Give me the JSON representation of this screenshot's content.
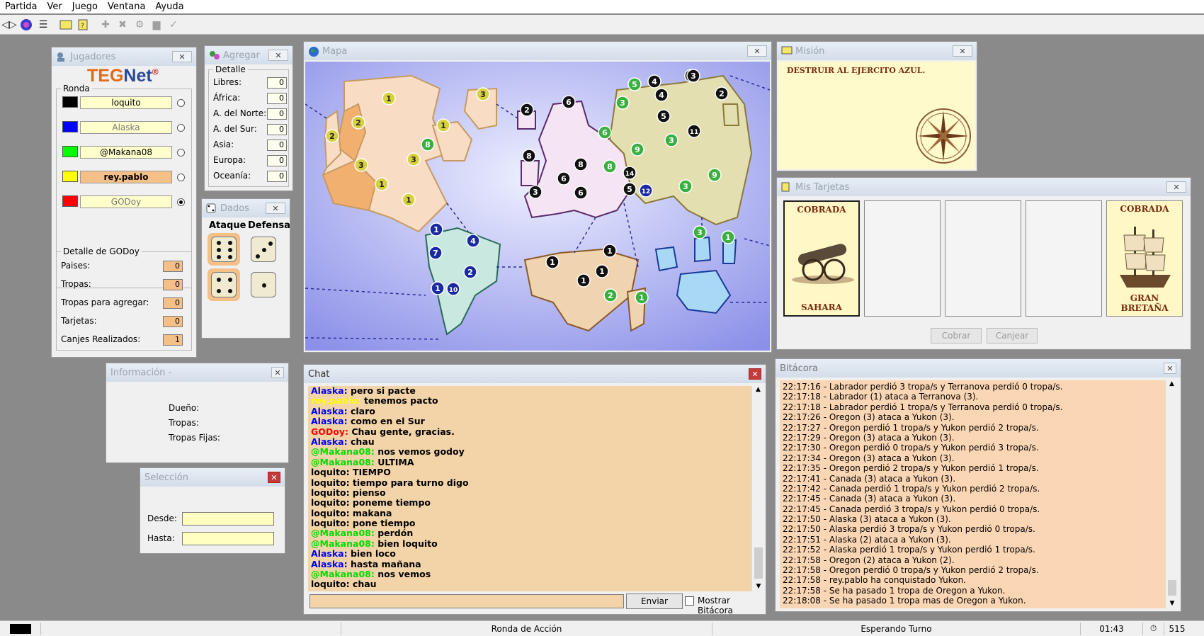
{
  "menu": [
    "Partida",
    "Ver",
    "Juego",
    "Ventana",
    "Ayuda"
  ],
  "jugadores": {
    "title": "Jugadores",
    "logo_a": "TEG",
    "logo_b": "Net",
    "logo_r": "®",
    "ronda_label": "Ronda",
    "players": [
      {
        "name": "loquito",
        "color": "#000000",
        "bold": false
      },
      {
        "name": "Alaska",
        "color": "#0000ff",
        "bold": false
      },
      {
        "name": "@Makana08",
        "color": "#00ff00",
        "bold": false
      },
      {
        "name": "rey.pablo",
        "color": "#ffff00",
        "bold": true
      },
      {
        "name": "GODoy",
        "color": "#ff0000",
        "bold": false
      }
    ],
    "detalle_title": "Detalle de GODoy",
    "detalle": [
      {
        "label": "Paises:",
        "value": "0"
      },
      {
        "label": "Tropas:",
        "value": "0"
      },
      {
        "label": "Tropas para agregar:",
        "value": "0"
      },
      {
        "label": "Tarjetas:",
        "value": "0"
      },
      {
        "label": "Canjes Realizados:",
        "value": "1"
      }
    ]
  },
  "agregar": {
    "title": "Agregar",
    "detalle_label": "Detalle",
    "rows": [
      {
        "label": "Libres:",
        "value": "0"
      },
      {
        "label": "África:",
        "value": "0"
      },
      {
        "label": "A. del Norte:",
        "value": "0"
      },
      {
        "label": "A. del Sur:",
        "value": "0"
      },
      {
        "label": "Asia:",
        "value": "0"
      },
      {
        "label": "Europa:",
        "value": "0"
      },
      {
        "label": "Oceanía:",
        "value": "0"
      }
    ]
  },
  "dados": {
    "title": "Dados",
    "ataque": "Ataque",
    "defensa": "Defensa",
    "attack": [
      6,
      4
    ],
    "defense": [
      3,
      1
    ]
  },
  "mapa": {
    "title": "Mapa"
  },
  "mision": {
    "title": "Misión",
    "text": "DESTRUIR AL EJERCITO AZUL."
  },
  "tarjetas": {
    "title": "Mis Tarjetas",
    "cards": [
      {
        "status": "COBRADA",
        "country": "SAHARA",
        "icon": "cannon-icon"
      },
      {
        "status": "COBRADA",
        "country": "GRAN BRETAÑA",
        "icon": "ship-icon"
      }
    ],
    "cobrar": "Cobrar",
    "canjear": "Canjear"
  },
  "info": {
    "title": "Información -",
    "dueno": "Dueño:",
    "tropas": "Tropas:",
    "tropas_fijas": "Tropas Fijas:"
  },
  "seleccion": {
    "title": "Selección",
    "desde": "Desde:",
    "hasta": "Hasta:"
  },
  "chat": {
    "title": "Chat",
    "send": "Enviar",
    "show_log": "Mostrar Bitácora",
    "lines": [
      {
        "who": "Alaska:",
        "c": "#0000ff",
        "msg": " pero si pacte"
      },
      {
        "who": "rey.pablo:",
        "c": "#ffff00",
        "msg": " tenemos pacto"
      },
      {
        "who": "Alaska:",
        "c": "#0000ff",
        "msg": " claro"
      },
      {
        "who": "Alaska:",
        "c": "#0000ff",
        "msg": " como en el Sur"
      },
      {
        "who": "GODoy:",
        "c": "#ff0000",
        "msg": " Chau gente, gracias."
      },
      {
        "who": "Alaska:",
        "c": "#0000ff",
        "msg": " chau"
      },
      {
        "who": "@Makana08:",
        "c": "#00dd00",
        "msg": " nos vemos godoy"
      },
      {
        "who": "@Makana08:",
        "c": "#00dd00",
        "msg": " ULTIMA"
      },
      {
        "who": "loquito:",
        "c": "#000000",
        "msg": " TIEMPO"
      },
      {
        "who": "loquito:",
        "c": "#000000",
        "msg": " tiempo para turno digo"
      },
      {
        "who": "loquito:",
        "c": "#000000",
        "msg": " pienso"
      },
      {
        "who": "loquito:",
        "c": "#000000",
        "msg": " poneme tiempo"
      },
      {
        "who": "loquito:",
        "c": "#000000",
        "msg": " makana"
      },
      {
        "who": "loquito:",
        "c": "#000000",
        "msg": " pone tiempo"
      },
      {
        "who": "@Makana08:",
        "c": "#00dd00",
        "msg": " perdón"
      },
      {
        "who": "@Makana08:",
        "c": "#00dd00",
        "msg": " bien loquito"
      },
      {
        "who": "Alaska:",
        "c": "#0000ff",
        "msg": " bien loco"
      },
      {
        "who": "Alaska:",
        "c": "#0000ff",
        "msg": " hasta mañana"
      },
      {
        "who": "@Makana08:",
        "c": "#00dd00",
        "msg": " nos vemos"
      },
      {
        "who": "loquito:",
        "c": "#000000",
        "msg": " chau"
      }
    ]
  },
  "bitacora": {
    "title": "Bitácora",
    "lines": [
      "22:17:16 - Labrador perdió 3 tropa/s y Terranova perdió 0 tropa/s.",
      "22:17:18 - Labrador (1) ataca a Terranova (3).",
      "22:17:18 - Labrador perdió 1 tropa/s y Terranova perdió 0 tropa/s.",
      "22:17:26 - Oregon (3) ataca a Yukon (3).",
      "22:17:27 - Oregon perdió 1 tropa/s y Yukon perdió 2 tropa/s.",
      "22:17:29 - Oregon (3) ataca a Yukon (3).",
      "22:17:30 - Oregon perdió 0 tropa/s y Yukon perdió 3 tropa/s.",
      "22:17:34 - Oregon (3) ataca a Yukon (3).",
      "22:17:35 - Oregon perdió 2 tropa/s y Yukon perdió 1 tropa/s.",
      "22:17:41 - Canada (3) ataca a Yukon (3).",
      "22:17:42 - Canada perdió 1 tropa/s y Yukon perdió 2 tropa/s.",
      "22:17:45 - Canada (3) ataca a Yukon (3).",
      "22:17:45 - Canada perdió 3 tropa/s y Yukon perdió 0 tropa/s.",
      "22:17:50 - Alaska (3) ataca a Yukon (3).",
      "22:17:50 - Alaska perdió 3 tropa/s y Yukon perdió 0 tropa/s.",
      "22:17:51 - Alaska (2) ataca a Yukon (3).",
      "22:17:52 - Alaska perdió 1 tropa/s y Yukon perdió 1 tropa/s.",
      "22:17:58 - Oregon (2) ataca a Yukon (2).",
      "22:17:58 - Oregon perdió 0 tropa/s y Yukon perdió 2 tropa/s.",
      "22:17:58 - rey.pablo ha conquistado Yukon.",
      "22:17:58 - Se ha pasado 1 tropa de Oregon a Yukon.",
      "22:18:08 - Se ha pasado 1 tropa mas de Oregon a Yukon."
    ]
  },
  "status": {
    "phase": "Ronda de Acción",
    "state": "Esperando Turno",
    "time": "01:43",
    "count": "515"
  },
  "armies": [
    {
      "n": "1",
      "t": "y"
    },
    {
      "n": "2",
      "t": "y"
    },
    {
      "n": "2",
      "t": "y"
    },
    {
      "n": "1",
      "t": "y"
    },
    {
      "n": "3",
      "t": "y"
    },
    {
      "n": "3",
      "t": "y"
    },
    {
      "n": "1",
      "t": "y"
    },
    {
      "n": "3",
      "t": "y"
    },
    {
      "n": "1",
      "t": "y"
    },
    {
      "n": "8",
      "t": "g"
    },
    {
      "n": "1",
      "t": "b"
    },
    {
      "n": "4",
      "t": "b"
    },
    {
      "n": "7",
      "t": "b"
    },
    {
      "n": "2",
      "t": "b"
    },
    {
      "n": "1",
      "t": "b"
    },
    {
      "n": "10",
      "t": "b"
    },
    {
      "n": "2",
      "t": "k"
    },
    {
      "n": "8",
      "t": "k"
    },
    {
      "n": "6",
      "t": "k"
    },
    {
      "n": "6",
      "t": "g"
    },
    {
      "n": "8",
      "t": "k"
    },
    {
      "n": "8",
      "t": "g"
    },
    {
      "n": "6",
      "t": "k"
    },
    {
      "n": "3",
      "t": "k"
    },
    {
      "n": "6",
      "t": "k"
    },
    {
      "n": "14",
      "t": "k"
    },
    {
      "n": "5",
      "t": "k"
    },
    {
      "n": "12",
      "t": "b"
    },
    {
      "n": "5",
      "t": "g"
    },
    {
      "n": "4",
      "t": "k"
    },
    {
      "n": "5",
      "t": "k"
    },
    {
      "n": "3",
      "t": "g"
    },
    {
      "n": "4",
      "t": "k"
    },
    {
      "n": "5",
      "t": "k"
    },
    {
      "n": "3",
      "t": "g"
    },
    {
      "n": "9",
      "t": "g"
    },
    {
      "n": "11",
      "t": "k"
    },
    {
      "n": "2",
      "t": "k"
    },
    {
      "n": "9",
      "t": "g"
    },
    {
      "n": "3",
      "t": "g"
    },
    {
      "n": "5",
      "t": "k"
    },
    {
      "n": "3",
      "t": "k"
    },
    {
      "n": "1",
      "t": "k"
    },
    {
      "n": "1",
      "t": "k"
    },
    {
      "n": "1",
      "t": "k"
    },
    {
      "n": "1",
      "t": "k"
    },
    {
      "n": "2",
      "t": "g"
    },
    {
      "n": "1",
      "t": "g"
    },
    {
      "n": "3",
      "t": "g"
    },
    {
      "n": "1",
      "t": "g"
    }
  ]
}
